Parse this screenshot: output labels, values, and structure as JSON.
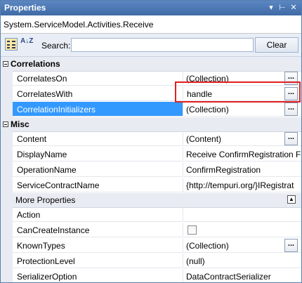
{
  "window": {
    "title": "Properties",
    "pin_glyph": "⊢",
    "close_glyph": "✕",
    "menu_glyph": "▾"
  },
  "subject": "System.ServiceModel.Activities.Receive",
  "toolbar": {
    "search_label": "Search:",
    "search_value": "",
    "clear_label": "Clear",
    "alpha_icon": "A↓Z"
  },
  "categories": {
    "correlations": {
      "name": "Correlations",
      "rows": [
        {
          "name": "CorrelatesOn",
          "value": "(Collection)",
          "has_ellipsis": true
        },
        {
          "name": "CorrelatesWith",
          "value": "handle",
          "has_ellipsis": true,
          "editing": true
        },
        {
          "name": "CorrelationInitializers",
          "value": "(Collection)",
          "has_ellipsis": true,
          "selected": true
        }
      ]
    },
    "misc": {
      "name": "Misc",
      "rows": [
        {
          "name": "Content",
          "value": "(Content)",
          "has_ellipsis": true
        },
        {
          "name": "DisplayName",
          "value": "Receive ConfirmRegistration F"
        },
        {
          "name": "OperationName",
          "value": "ConfirmRegistration"
        },
        {
          "name": "ServiceContractName",
          "value": "{http://tempuri.org/}IRegistrat"
        }
      ]
    }
  },
  "more_properties": {
    "label": "More Properties",
    "rows": [
      {
        "name": "Action",
        "value": ""
      },
      {
        "name": "CanCreateInstance",
        "value": "",
        "checkbox": true,
        "checked": false
      },
      {
        "name": "KnownTypes",
        "value": "(Collection)",
        "has_ellipsis": true
      },
      {
        "name": "ProtectionLevel",
        "value": "(null)"
      },
      {
        "name": "SerializerOption",
        "value": "DataContractSerializer"
      }
    ]
  },
  "ellipsis_label": "...",
  "colors": {
    "titlebar": "#4a78b6",
    "selection": "#3399ff",
    "highlight_box": "#e02020",
    "category_bg": "#e8ebf1"
  }
}
